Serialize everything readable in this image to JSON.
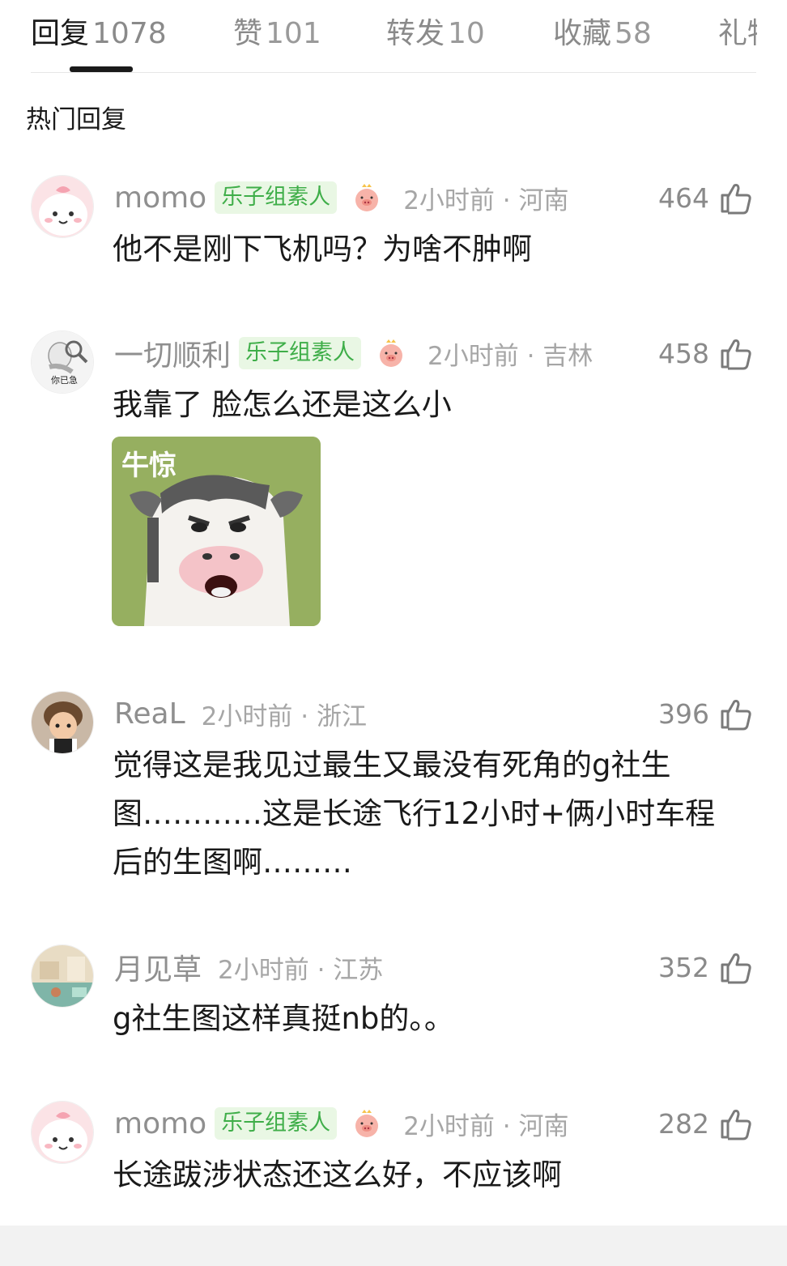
{
  "tabs": [
    {
      "label": "回复",
      "count": "1078"
    },
    {
      "label": "赞",
      "count": "101"
    },
    {
      "label": "转发",
      "count": "10"
    },
    {
      "label": "收藏",
      "count": "58"
    },
    {
      "label": "礼物",
      "count": ""
    }
  ],
  "section_title": "热门回复",
  "comments": [
    {
      "user": "momo",
      "badge": "乐子组素人",
      "time": "2小时前 · 河南",
      "likes": "464",
      "text": "他不是刚下飞机吗？为啥不肿啊"
    },
    {
      "user": "一切顺利",
      "badge": "乐子组素人",
      "time": "2小时前 · 吉林",
      "likes": "458",
      "text": "我靠了 脸怎么还是这么小",
      "sticker_caption": "牛惊",
      "avatar_caption": "你已急"
    },
    {
      "user": "ReaL",
      "time": "2小时前 · 浙江",
      "likes": "396",
      "text": "觉得这是我见过最生又最没有死角的g社生图…………这是长途飞行12小时+俩小时车程后的生图啊………"
    },
    {
      "user": "月见草",
      "time": "2小时前 · 江苏",
      "likes": "352",
      "text": "g社生图这样真挺nb的。。"
    },
    {
      "user": "momo",
      "badge": "乐子组素人",
      "time": "2小时前 · 河南",
      "likes": "282",
      "text": "长途跋涉状态还这么好，不应该啊"
    }
  ],
  "icons": {
    "like": "thumbs-up-icon",
    "badge_pig": "pig-face-icon"
  },
  "colors": {
    "badge_text": "#3fae49",
    "badge_bg": "#e9f7e4",
    "meta_gray": "#a6a6a6"
  }
}
